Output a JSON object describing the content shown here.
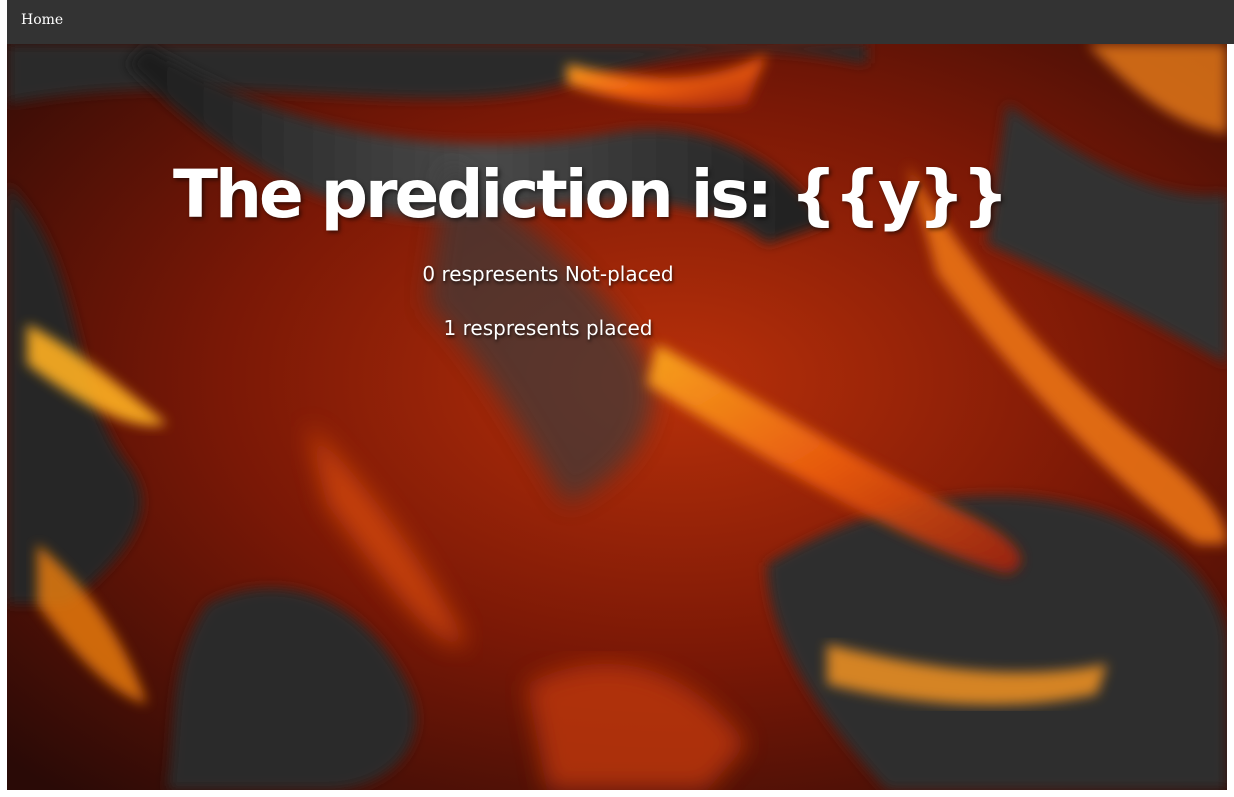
{
  "nav": {
    "home_label": "Home"
  },
  "main": {
    "headline": "The prediction is: {{y}}",
    "legend": [
      "0 respresents Not-placed",
      "1 respresents placed"
    ]
  },
  "colors": {
    "navbar": "#333333",
    "text": "#ffffff",
    "background_accent": "#e04a0a"
  }
}
